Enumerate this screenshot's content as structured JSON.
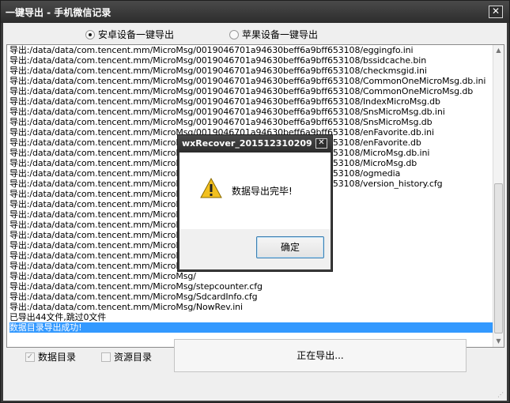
{
  "window": {
    "title": "一键导出 - 手机微信记录",
    "close_glyph": "✕"
  },
  "mode": {
    "android_label": "安卓设备一键导出",
    "apple_label": "苹果设备一键导出",
    "selected": "android"
  },
  "log": {
    "lines": [
      "导出:/data/data/com.tencent.mm/MicroMsg/0019046701a94630beff6a9bff653108/eggingfo.ini",
      "导出:/data/data/com.tencent.mm/MicroMsg/0019046701a94630beff6a9bff653108/bssidcache.bin",
      "导出:/data/data/com.tencent.mm/MicroMsg/0019046701a94630beff6a9bff653108/checkmsgid.ini",
      "导出:/data/data/com.tencent.mm/MicroMsg/0019046701a94630beff6a9bff653108/CommonOneMicroMsg.db.ini",
      "导出:/data/data/com.tencent.mm/MicroMsg/0019046701a94630beff6a9bff653108/CommonOneMicroMsg.db",
      "导出:/data/data/com.tencent.mm/MicroMsg/0019046701a94630beff6a9bff653108/IndexMicroMsg.db",
      "导出:/data/data/com.tencent.mm/MicroMsg/0019046701a94630beff6a9bff653108/SnsMicroMsg.db.ini",
      "导出:/data/data/com.tencent.mm/MicroMsg/0019046701a94630beff6a9bff653108/SnsMicroMsg.db",
      "导出:/data/data/com.tencent.mm/MicroMsg/0019046701a94630beff6a9bff653108/enFavorite.db.ini",
      "导出:/data/data/com.tencent.mm/MicroMsg/0019046701a94630beff6a9bff653108/enFavorite.db",
      "导出:/data/data/com.tencent.mm/MicroMsg/0019046701a94630beff6a9bff653108/MicroMsg.db.ini",
      "导出:/data/data/com.tencent.mm/MicroMsg/0019046701a94630beff6a9bff653108/MicroMsg.db",
      "导出:/data/data/com.tencent.mm/MicroMsg/0019046701a94630beff6a9bff653108/ogmedia",
      "导出:/data/data/com.tencent.mm/MicroMsg/0019046701a94630beff6a9bff653108/version_history.cfg",
      "导出:/data/data/com.tencent.mm/MicroMsg/",
      "导出:/data/data/com.tencent.mm/MicroMsg/",
      "导出:/data/data/com.tencent.mm/MicroMsg/",
      "导出:/data/data/com.tencent.mm/MicroMsg/",
      "导出:/data/data/com.tencent.mm/MicroMsg/",
      "导出:/data/data/com.tencent.mm/MicroMsg/",
      "导出:/data/data/com.tencent.mm/MicroMsg/",
      "导出:/data/data/com.tencent.mm/MicroMsg/",
      "导出:/data/data/com.tencent.mm/MicroMsg/",
      "导出:/data/data/com.tencent.mm/MicroMsg/stepcounter.cfg",
      "导出:/data/data/com.tencent.mm/MicroMsg/SdcardInfo.cfg",
      "导出:/data/data/com.tencent.mm/MicroMsg/NowRev.ini",
      "已导出44文件,跳过0文件",
      "数据目录导出成功!"
    ],
    "selected_index": 27
  },
  "options": {
    "data_dir_label": "数据目录",
    "data_dir_checked": true,
    "res_dir_label": "资源目录",
    "res_dir_checked": false
  },
  "status_button": {
    "label": "正在导出..."
  },
  "dialog": {
    "title": "wxRecover_201512310209",
    "close_glyph": "✕",
    "message": "数据导出完毕!",
    "ok_label": "确定"
  },
  "colors": {
    "title_bar": "#2c2c2c",
    "selection": "#3399ff",
    "warning": "#f2c01e"
  }
}
